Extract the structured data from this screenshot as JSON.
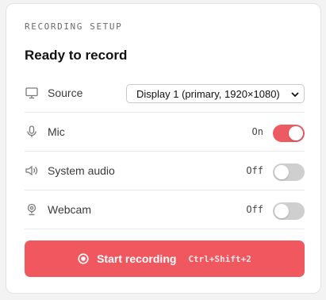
{
  "header": {
    "eyebrow": "RECORDING SETUP",
    "title": "Ready to record"
  },
  "rows": {
    "source": {
      "label": "Source",
      "icon": "monitor-icon",
      "selected_value": "Display 1 (primary, 1920×1080)"
    },
    "mic": {
      "label": "Mic",
      "icon": "microphone-icon",
      "state_text": "On",
      "enabled": true
    },
    "system_audio": {
      "label": "System audio",
      "icon": "speaker-icon",
      "state_text": "Off",
      "enabled": false
    },
    "webcam": {
      "label": "Webcam",
      "icon": "webcam-icon",
      "state_text": "Off",
      "enabled": false
    }
  },
  "cta": {
    "label": "Start recording",
    "shortcut": "Ctrl+Shift+2",
    "icon": "record-icon"
  },
  "colors": {
    "accent": "#f0575f",
    "toggle_on": "#ee5a62",
    "toggle_off": "#cfcfcf"
  }
}
